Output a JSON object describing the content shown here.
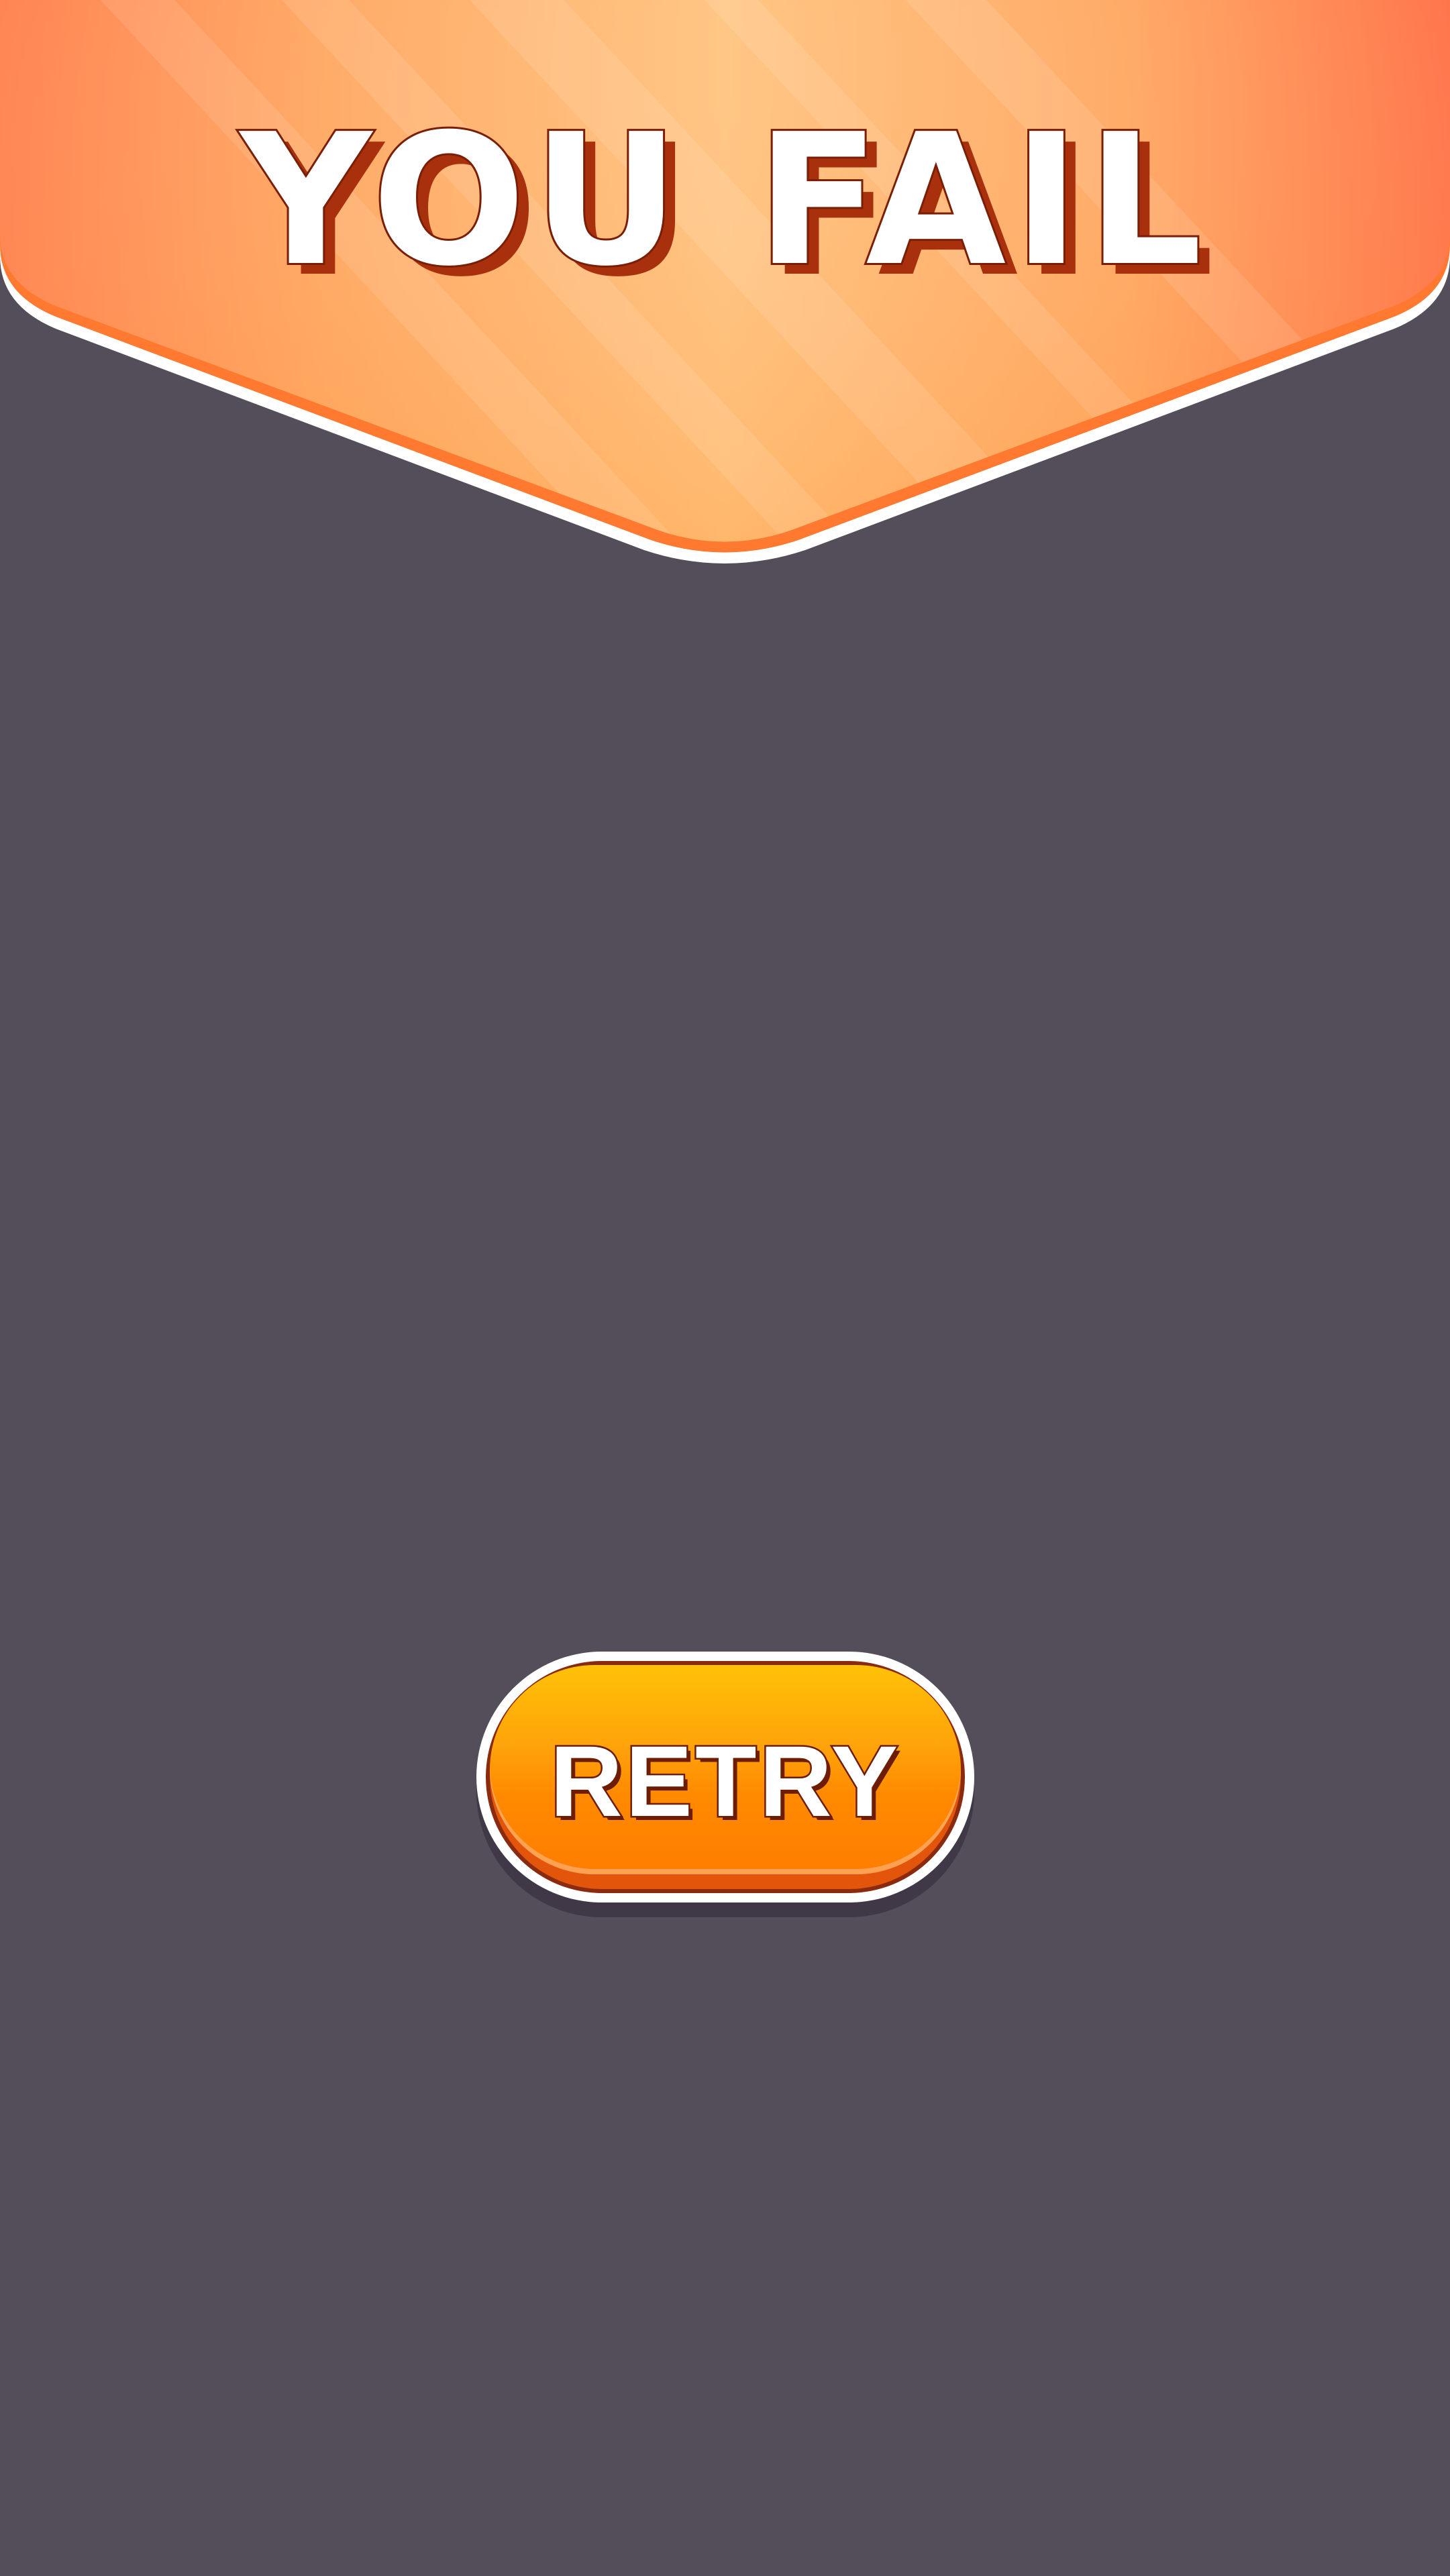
{
  "screen": "game-over",
  "banner": {
    "title": "YOU FAIL",
    "colors": {
      "gradient_light": "#ffc17a",
      "gradient_dark": "#ff7a45",
      "rim": "#ff7a30",
      "outline": "#ffffff",
      "title_fill": "#ffffff",
      "title_shadow": "#a8300d",
      "title_stroke": "#7a1e06"
    }
  },
  "retry_button": {
    "label": "RETRY",
    "colors": {
      "top": "#ffc107",
      "bottom": "#ff7d00",
      "base": "#e2550b",
      "outline": "#8a2a0e"
    }
  },
  "background_color": "#544e5a"
}
